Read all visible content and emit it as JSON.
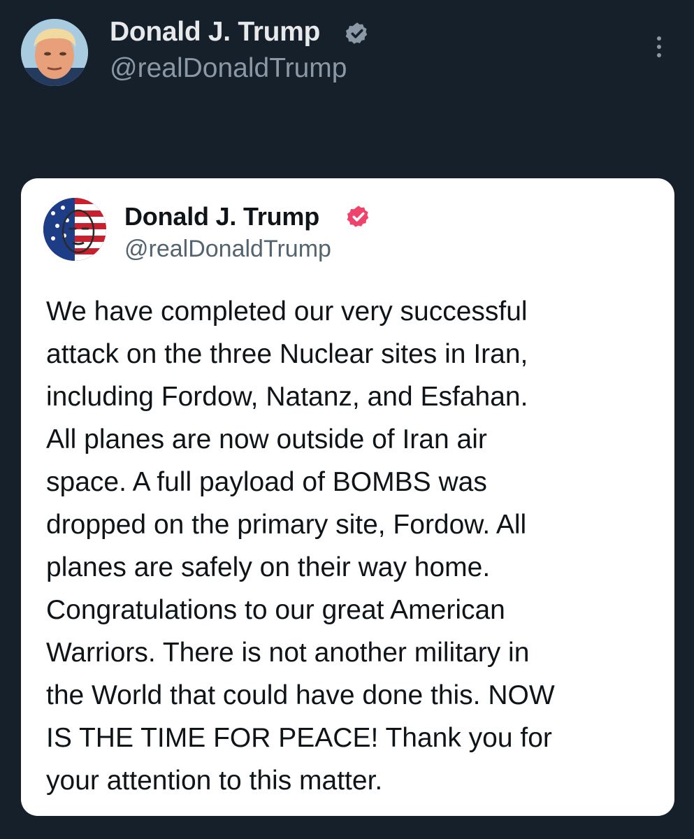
{
  "post": {
    "author_name": "Donald J. Trump",
    "author_handle": "@realDonaldTrump",
    "avatar_icon": "profile-photo",
    "verified_icon": "verified-badge-icon",
    "more_icon": "more-options-icon"
  },
  "quoted_post": {
    "author_name": "Donald J. Trump",
    "author_handle": "@realDonaldTrump",
    "avatar_icon": "stars-and-stripes-portrait",
    "verified_icon": "verified-badge-icon",
    "verified_color": "#f0436b",
    "text": "We have completed our very successful\nattack on the three Nuclear sites in Iran,\nincluding Fordow, Natanz, and Esfahan.\nAll planes are now outside of Iran air\nspace. A full payload of BOMBS was\ndropped on the primary site, Fordow. All\nplanes are safely on their way home.\nCongratulations to our great American\nWarriors. There is not another military in\nthe World that could have done this. NOW\nIS THE TIME FOR PEACE! Thank you for\nyour attention to this matter."
  },
  "colors": {
    "background": "#15202b",
    "name_text": "#e7e9ea",
    "handle_text": "#8b98a5",
    "card_background": "#ffffff",
    "card_text": "#0f1419",
    "card_handle_text": "#536471"
  }
}
